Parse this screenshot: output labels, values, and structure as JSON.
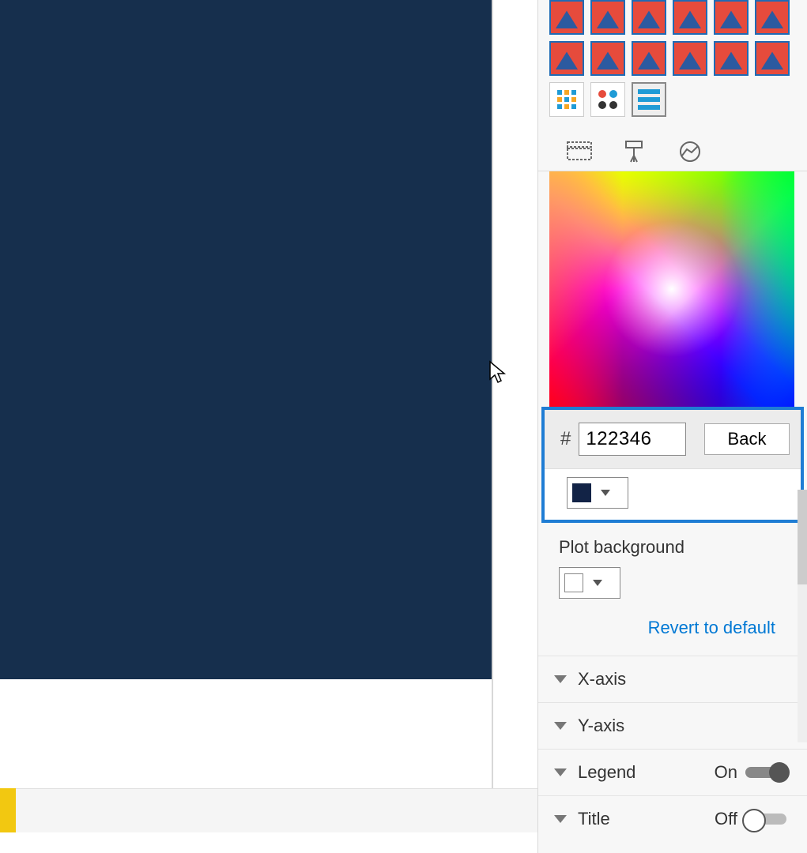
{
  "canvas": {
    "bg_color": "#162f4d"
  },
  "color_input": {
    "prefix": "#",
    "value": "122346",
    "back_label": "Back",
    "swatch_color": "#122346"
  },
  "plot_bg": {
    "label": "Plot background",
    "swatch_color": "#ffffff"
  },
  "revert_label": "Revert to default",
  "sections": {
    "xaxis": {
      "label": "X-axis"
    },
    "yaxis": {
      "label": "Y-axis"
    },
    "legend": {
      "label": "Legend",
      "toggle_label": "On",
      "state": "on"
    },
    "title": {
      "label": "Title",
      "toggle_label": "Off",
      "state": "off"
    }
  }
}
